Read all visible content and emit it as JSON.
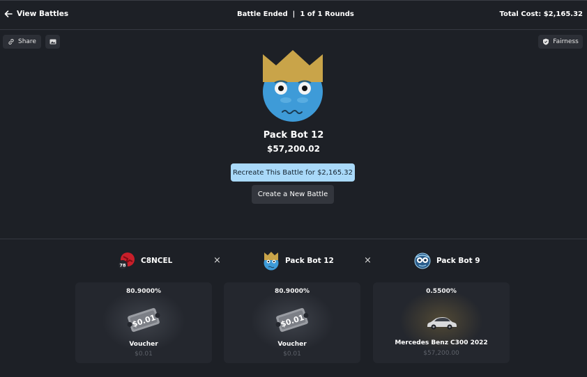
{
  "header": {
    "back_label": "View Battles",
    "status": "Battle Ended",
    "separator": "|",
    "rounds": "1 of 1 Rounds",
    "total_cost": "Total Cost: $2,165.32"
  },
  "toolbar": {
    "share_label": "Share",
    "fairness_label": "Fairness"
  },
  "winner": {
    "name": "Pack Bot 12",
    "amount": "$57,200.02",
    "recreate_label": "Recreate This Battle for $2,165.32",
    "new_battle_label": "Create a New Battle"
  },
  "players": [
    {
      "name": "C8NCEL",
      "level": "78",
      "icon": "red-avatar-icon"
    },
    {
      "name": "Pack Bot 12",
      "icon": "crown-bot-avatar-icon"
    },
    {
      "name": "Pack Bot 9",
      "icon": "blue-bot-avatar-icon"
    }
  ],
  "vs_symbol": "×",
  "cards": [
    {
      "percent": "80.9000%",
      "item": "Voucher",
      "value": "$0.01",
      "voucher_text": "$0.01",
      "icon": "voucher-icon"
    },
    {
      "percent": "80.9000%",
      "item": "Voucher",
      "value": "$0.01",
      "voucher_text": "$0.01",
      "icon": "voucher-icon"
    },
    {
      "percent": "0.5500%",
      "item": "Mercedes Benz C300 2022",
      "value": "$57,200.00",
      "icon": "car-icon"
    }
  ],
  "colors": {
    "background": "#1d2026",
    "card": "#24272e",
    "accent_button": "#a9d9f9",
    "crown": "#c9a449",
    "bot_blue": "#3e9bd8"
  }
}
